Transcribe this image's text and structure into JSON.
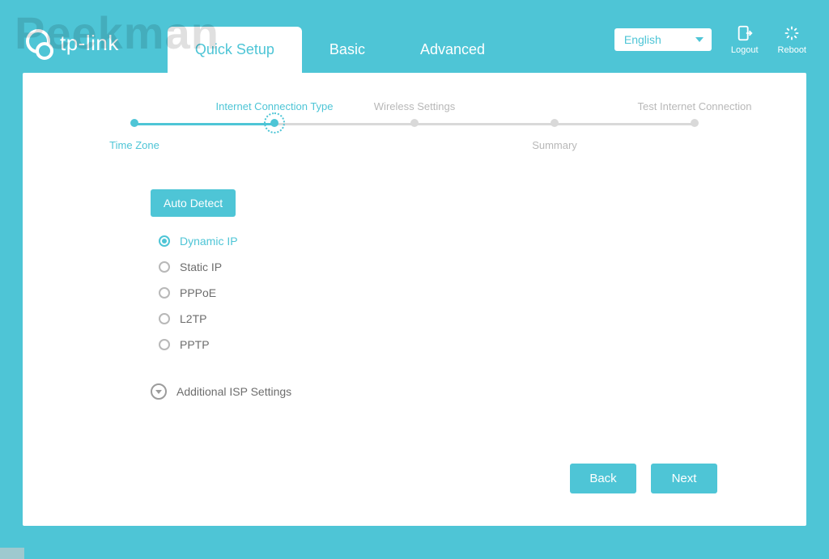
{
  "watermark": "Peekman",
  "brand": "tp-link",
  "tabs": {
    "quick_setup": "Quick Setup",
    "basic": "Basic",
    "advanced": "Advanced"
  },
  "language": {
    "selected": "English"
  },
  "utility": {
    "logout": "Logout",
    "reboot": "Reboot"
  },
  "stepper": {
    "time_zone": "Time Zone",
    "internet_connection_type": "Internet Connection Type",
    "wireless_settings": "Wireless Settings",
    "summary": "Summary",
    "test_internet_connection": "Test Internet Connection"
  },
  "content": {
    "auto_detect": "Auto Detect",
    "options": {
      "dynamic_ip": "Dynamic IP",
      "static_ip": "Static IP",
      "pppoe": "PPPoE",
      "l2tp": "L2TP",
      "pptp": "PPTP"
    },
    "additional_isp": "Additional ISP Settings"
  },
  "buttons": {
    "back": "Back",
    "next": "Next"
  }
}
